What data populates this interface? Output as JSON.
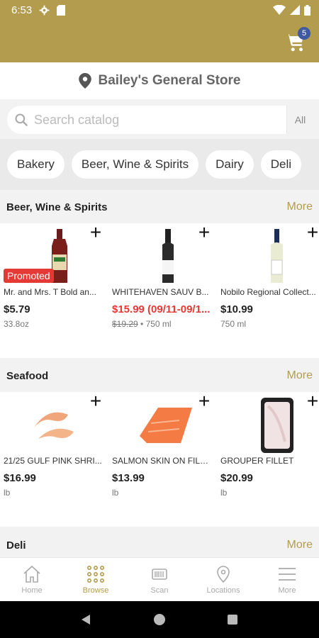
{
  "status": {
    "time": "6:53"
  },
  "cart": {
    "count": "5"
  },
  "store": {
    "name": "Bailey's General Store"
  },
  "search": {
    "placeholder": "Search catalog",
    "scope": "All"
  },
  "categories": [
    "Bakery",
    "Beer, Wine & Spirits",
    "Dairy",
    "Deli"
  ],
  "sections": [
    {
      "title": "Beer, Wine & Spirits",
      "more": "More",
      "products": [
        {
          "name": "Mr. and Mrs. T Bold an...",
          "price": "$5.79",
          "size": "33.8oz",
          "badge": "Promoted"
        },
        {
          "name": "WHITEHAVEN SAUV B...",
          "price": "$15.99 (09/11-09/1...",
          "old_price": "$19.29",
          "size": "750 ml"
        },
        {
          "name": "Nobilo Regional Collect...",
          "price": "$10.99",
          "size": "750 ml"
        }
      ]
    },
    {
      "title": "Seafood",
      "more": "More",
      "products": [
        {
          "name": "21/25 GULF PINK SHRI...",
          "price": "$16.99",
          "size": "lb"
        },
        {
          "name": "SALMON SKIN ON FILL...",
          "price": "$13.99",
          "size": "lb"
        },
        {
          "name": "GROUPER FILLET",
          "price": "$20.99",
          "size": "lb"
        }
      ]
    },
    {
      "title": "Deli",
      "more": "More"
    }
  ],
  "nav": [
    {
      "label": "Home",
      "icon": "home-icon"
    },
    {
      "label": "Browse",
      "icon": "browse-grid-icon"
    },
    {
      "label": "Scan",
      "icon": "barcode-icon"
    },
    {
      "label": "Locations",
      "icon": "location-pin-icon"
    },
    {
      "label": "More",
      "icon": "menu-icon"
    }
  ],
  "colors": {
    "brand": "#b39c4d",
    "sale": "#e53935",
    "badge": "#3f5aa0"
  }
}
